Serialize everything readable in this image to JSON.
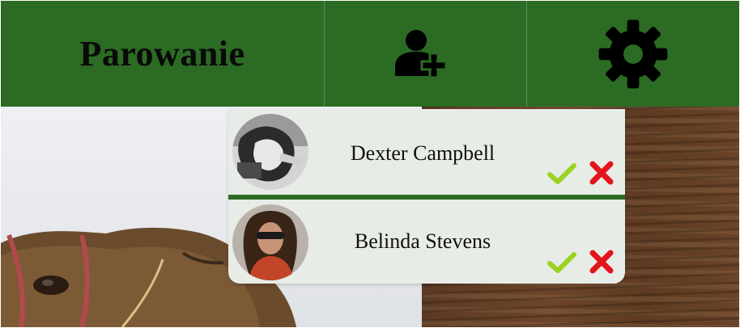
{
  "header": {
    "title": "Parowanie",
    "add_icon": "add-user-icon",
    "settings_icon": "gear-icon",
    "bar_color": "#2c6b23"
  },
  "requests": [
    {
      "name": "Dexter Campbell",
      "accept_icon": "check-icon",
      "reject_icon": "close-icon"
    },
    {
      "name": "Belinda Stevens",
      "accept_icon": "check-icon",
      "reject_icon": "close-icon"
    }
  ],
  "colors": {
    "accept": "#9bd21e",
    "reject": "#e3141e",
    "panel": "#e8ece6"
  }
}
